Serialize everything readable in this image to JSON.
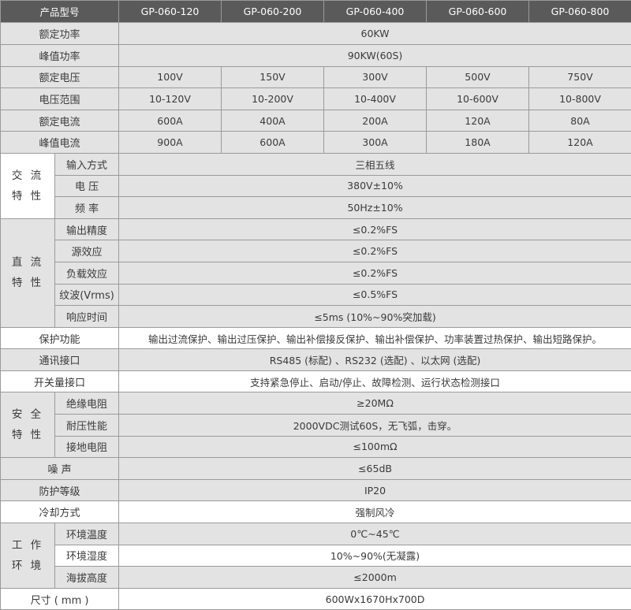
{
  "table": {
    "header": {
      "label": "产品型号",
      "models": [
        "GP-060-120",
        "GP-060-200",
        "GP-060-400",
        "GP-060-600",
        "GP-060-800"
      ]
    },
    "rated_power": {
      "label": "额定功率",
      "value": "60KW"
    },
    "peak_power": {
      "label": "峰值功率",
      "value": "90KW(60S)"
    },
    "rated_voltage": {
      "label": "额定电压",
      "values": [
        "100V",
        "150V",
        "300V",
        "500V",
        "750V"
      ]
    },
    "voltage_range": {
      "label": "电压范围",
      "values": [
        "10-120V",
        "10-200V",
        "10-400V",
        "10-600V",
        "10-800V"
      ]
    },
    "rated_current": {
      "label": "额定电流",
      "values": [
        "600A",
        "400A",
        "200A",
        "120A",
        "80A"
      ]
    },
    "peak_current": {
      "label": "峰值电流",
      "values": [
        "900A",
        "600A",
        "300A",
        "180A",
        "120A"
      ]
    },
    "ac": {
      "group_line1": "交 流",
      "group_line2": "特 性",
      "rows": [
        {
          "label": "输入方式",
          "value": "三相五线"
        },
        {
          "label": "电 压",
          "value": "380V±10%"
        },
        {
          "label": "频 率",
          "value": "50Hz±10%"
        }
      ]
    },
    "dc": {
      "group_line1": "直 流",
      "group_line2": "特 性",
      "rows": [
        {
          "label": "输出精度",
          "value": "≤0.2%FS"
        },
        {
          "label": "源效应",
          "value": "≤0.2%FS"
        },
        {
          "label": "负载效应",
          "value": "≤0.2%FS"
        },
        {
          "label": "纹波(Vrms)",
          "value": "≤0.5%FS"
        },
        {
          "label": "响应时间",
          "value": "≤5ms (10%~90%突加载)"
        }
      ]
    },
    "protection": {
      "label": "保护功能",
      "value": "输出过流保护、输出过压保护、输出补偿接反保护、输出补偿保护、功率装置过热保护、输出短路保护。"
    },
    "communication": {
      "label": "通讯接口",
      "value": "RS485 (标配) 、RS232 (选配) 、以太网 (选配)"
    },
    "switch_interface": {
      "label": "开关量接口",
      "value": "支持紧急停止、启动/停止、故障检测、运行状态检测接口"
    },
    "safety": {
      "group_line1": "安 全",
      "group_line2": "特 性",
      "rows": [
        {
          "label": "绝缘电阻",
          "value": "≥20MΩ"
        },
        {
          "label": "耐压性能",
          "value": "2000VDC测试60S，无飞弧，击穿。"
        },
        {
          "label": "接地电阻",
          "value": "≤100mΩ"
        }
      ]
    },
    "noise": {
      "label": "噪 声",
      "value": "≤65dB"
    },
    "ip_rating": {
      "label": "防护等级",
      "value": "IP20"
    },
    "cooling": {
      "label": "冷却方式",
      "value": "强制风冷"
    },
    "environment": {
      "group_line1": "工 作",
      "group_line2": "环 境",
      "rows": [
        {
          "label": "环境温度",
          "value": "0℃~45℃"
        },
        {
          "label": "环境湿度",
          "value": "10%~90%(无凝露)"
        },
        {
          "label": "海拔高度",
          "value": "≤2000m"
        }
      ]
    },
    "dimensions": {
      "label": "尺寸 ( mm )",
      "value": "600Wx1670Hx700D"
    }
  }
}
